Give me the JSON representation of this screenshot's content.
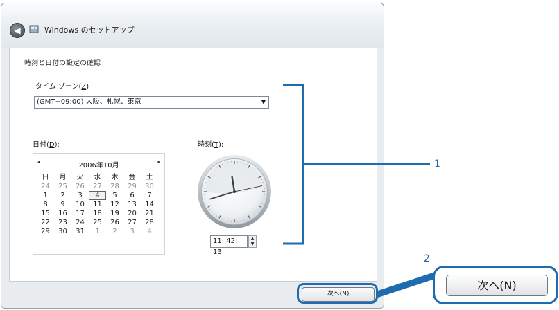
{
  "window": {
    "title": "Windows のセットアップ"
  },
  "content": {
    "heading": "時刻と日付の設定の確認",
    "timezone": {
      "label_prefix": "タイム ゾーン(",
      "label_key": "Z",
      "label_suffix": ")",
      "value": "(GMT+09:00) 大阪、札幌、東京"
    },
    "date": {
      "label_prefix": "日付(",
      "label_key": "D",
      "label_suffix": "):"
    },
    "time": {
      "label_prefix": "時刻(",
      "label_key": "T",
      "label_suffix": "):",
      "value": "11: 42: 13"
    },
    "calendar": {
      "month": "2006年10月",
      "prev": "◂",
      "next": "▸",
      "weekdays": [
        "日",
        "月",
        "火",
        "水",
        "木",
        "金",
        "土"
      ],
      "days": [
        "24",
        "25",
        "26",
        "27",
        "28",
        "29",
        "30",
        "1",
        "2",
        "3",
        "4",
        "5",
        "6",
        "7",
        "8",
        "9",
        "10",
        "11",
        "12",
        "13",
        "14",
        "15",
        "16",
        "17",
        "18",
        "19",
        "20",
        "21",
        "22",
        "23",
        "24",
        "25",
        "26",
        "27",
        "28",
        "29",
        "30",
        "31",
        "1",
        "2",
        "3",
        "4"
      ],
      "dim_days": [
        0,
        1,
        2,
        3,
        4,
        5,
        6,
        38,
        39,
        40,
        41
      ],
      "selected_index": 10
    },
    "clock": {
      "hour": 11,
      "minute": 42,
      "second": 13
    }
  },
  "footer": {
    "next_label": "次へ(N)"
  },
  "callouts": {
    "one": "1",
    "two": "2",
    "zoom_next_label": "次へ(N)"
  },
  "colors": {
    "accent": "#1e6bb0"
  }
}
